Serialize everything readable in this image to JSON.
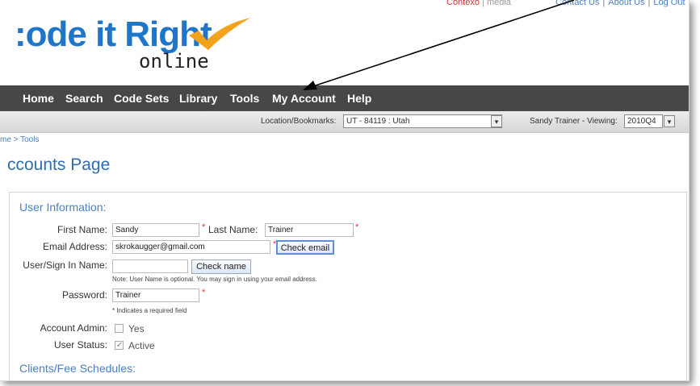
{
  "logo": {
    "main": "Code it Right",
    "sub": "online",
    "visible_main": ":ode it Right"
  },
  "brand": {
    "name": "Contexo",
    "suffix": "media"
  },
  "top_links": [
    "Contact Us",
    "About Us",
    "Log Out"
  ],
  "nav": {
    "items": [
      "Home",
      "Search",
      "Code Sets",
      "Library",
      "Tools",
      "My Account",
      "Help"
    ]
  },
  "location_bar": {
    "location_label": "Location/Bookmarks:",
    "location_value": "UT - 84119 : Utah",
    "user_label": "Sandy Trainer - Viewing:",
    "viewing_value": "2010Q4"
  },
  "breadcrumb": "me > Tools",
  "page_title": "ccounts Page",
  "user_info": {
    "heading": "User Information:",
    "first_name_label": "First Name:",
    "first_name_value": "Sandy",
    "last_name_label": "Last Name:",
    "last_name_value": "Trainer",
    "email_label": "Email Address:",
    "email_value": "skrokaugger@gmail.com",
    "check_email_label": "Check email",
    "username_label": "User/Sign In Name:",
    "username_value": "",
    "check_name_label": "Check name",
    "username_note": "Note: User Name is optional. You may sign in using your email address.",
    "password_label": "Password:",
    "password_value": "Trainer",
    "required_note": "* Indicates a required field",
    "account_admin_label": "Account Admin:",
    "account_admin_option": "Yes",
    "user_status_label": "User Status:",
    "user_status_option": "Active"
  },
  "clients_heading": "Clients/Fee Schedules:",
  "colors": {
    "nav_bg": "#474747",
    "accent_blue": "#2e6db0",
    "logo_blue": "#1f75c7",
    "check_orange": "#f3a21c"
  }
}
